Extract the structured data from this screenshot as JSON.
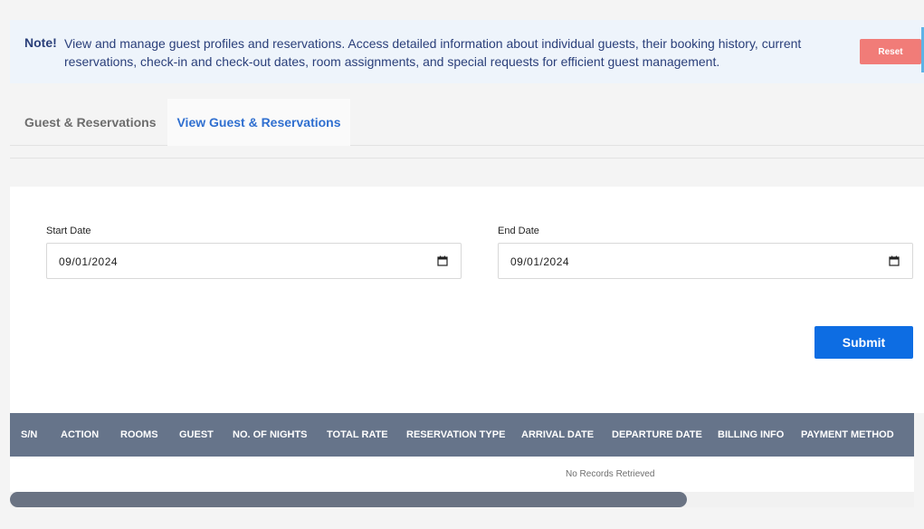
{
  "note": {
    "label": "Note!",
    "text": "View and manage guest profiles and reservations. Access detailed information about individual guests, their booking history, current reservations, check-in and check-out dates, room assignments, and special requests for efficient guest management.",
    "reset_label": "Reset"
  },
  "tabs": [
    {
      "label": "Guest & Reservations",
      "active": false
    },
    {
      "label": "View Guest & Reservations",
      "active": true
    }
  ],
  "form": {
    "start_date_label": "Start Date",
    "start_date_value": "09/01/2024",
    "end_date_label": "End Date",
    "end_date_value": "09/01/2024",
    "submit_label": "Submit"
  },
  "table": {
    "columns": [
      "S/N",
      "ACTION",
      "ROOMS",
      "GUEST",
      "NO. OF NIGHTS",
      "TOTAL RATE",
      "RESERVATION TYPE",
      "ARRIVAL DATE",
      "DEPARTURE DATE",
      "BILLING INFO",
      "PAYMENT METHOD"
    ],
    "empty_message": "No Records Retrieved"
  },
  "colors": {
    "accent": "#0d6de3",
    "reset": "#f17c78",
    "table_header": "#66748a",
    "active_tab": "#2f6fd0"
  },
  "icons": {
    "date_picker": "calendar-icon"
  }
}
